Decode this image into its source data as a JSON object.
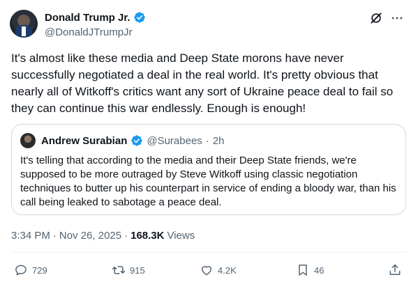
{
  "author": {
    "display_name": "Donald Trump Jr.",
    "handle": "@DonaldJTrumpJr"
  },
  "icons": {
    "verified": "verified-badge-icon",
    "grok": "grok-icon",
    "more": "more-icon"
  },
  "tweet": {
    "text": "It's almost like these media and Deep State morons have never successfully negotiated a deal in the real world. It's pretty obvious that nearly all of Witkoff's critics want any sort of Ukraine peace deal to fail so they can continue this war endlessly. Enough is enough!"
  },
  "quote": {
    "display_name": "Andrew Surabian",
    "handle": "@Surabees",
    "separator": "·",
    "time": "2h",
    "text": "It's telling that according to the media and their Deep State friends, we're supposed to be more outraged by Steve Witkoff using classic negotiation techniques to butter up his counterpart in service of ending a bloody war, than his call being leaked to sabotage a peace deal."
  },
  "meta": {
    "time": "3:34 PM",
    "sep1": "·",
    "date": "Nov 26, 2025",
    "sep2": "·",
    "views_count": "168.3K",
    "views_label": "Views"
  },
  "actions": {
    "replies": "729",
    "reposts": "915",
    "likes": "4.2K",
    "bookmarks": "46"
  },
  "colors": {
    "text": "#0f1419",
    "secondary": "#536471",
    "border": "#cfd9de",
    "verified": "#1d9bf0"
  }
}
